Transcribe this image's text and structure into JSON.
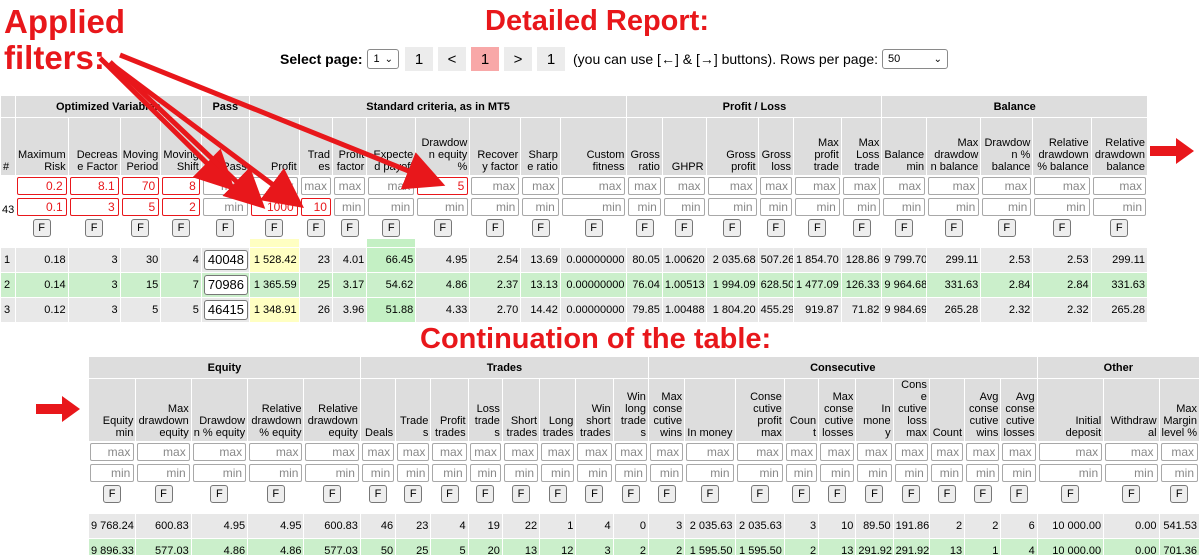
{
  "annotations": {
    "applied_filters": "Applied\nfilters:",
    "detailed_report": "Detailed Report:",
    "continuation": "Continuation of the table:"
  },
  "pager": {
    "select_label": "Select page:",
    "select_value": "1",
    "first": "1",
    "prev": "<",
    "current": "1",
    "next": ">",
    "last": "1",
    "note": "(you can use [←] & [→] buttons). Rows per page:",
    "rows_value": "50"
  },
  "filter_button": "F",
  "table1": {
    "groups": {
      "opt": "Optimized Variables",
      "pass": "Pass",
      "std": "Standard criteria, as in MT5",
      "pl": "Profit / Loss",
      "bal": "Balance"
    },
    "rows_count": "43",
    "headers": [
      "#",
      "Maximum Risk",
      "Decrease Factor",
      "Moving Period",
      "Moving Shift",
      "Pass",
      "Profit",
      "Trades",
      "Profit factor",
      "Expected payoff",
      "Drawdown equity %",
      "Recovery factor",
      "Sharpe ratio",
      "Custom fitness",
      "Gross ratio",
      "GHPR",
      "Gross profit",
      "Gross loss",
      "Max profit trade",
      "Max Loss trade",
      "Balance min",
      "Max drawdown balance",
      "Drawdown % balance",
      "Relative drawdown % balance",
      "Relative drawdown balance"
    ],
    "max_filters": [
      "0.2",
      "8.1",
      "70",
      "8",
      "max",
      "max",
      "max",
      "max",
      "max",
      "5",
      "max",
      "max",
      "max",
      "max",
      "max",
      "max",
      "max",
      "max",
      "max",
      "max",
      "max",
      "max",
      "max",
      "max"
    ],
    "min_filters": [
      "0.1",
      "3",
      "5",
      "2",
      "min",
      "1000",
      "10",
      "min",
      "min",
      "min",
      "min",
      "min",
      "min",
      "min",
      "min",
      "min",
      "min",
      "min",
      "min",
      "min",
      "min",
      "min",
      "min",
      "min"
    ],
    "rows": [
      [
        "1",
        "0.18",
        "3",
        "30",
        "4",
        "40048",
        "1 528.42",
        "23",
        "4.01",
        "66.45",
        "4.95",
        "2.54",
        "13.69",
        "0.00000000",
        "80.05",
        "1.00620",
        "2 035.68",
        "507.26",
        "1 854.70",
        "128.86",
        "9 799.70",
        "299.11",
        "2.53",
        "2.53",
        "299.11"
      ],
      [
        "2",
        "0.14",
        "3",
        "15",
        "7",
        "70986",
        "1 365.59",
        "25",
        "3.17",
        "54.62",
        "4.86",
        "2.37",
        "13.13",
        "0.00000000",
        "76.04",
        "1.00513",
        "1 994.09",
        "628.50",
        "1 477.09",
        "126.33",
        "9 964.68",
        "331.63",
        "2.84",
        "2.84",
        "331.63"
      ],
      [
        "3",
        "0.12",
        "3",
        "5",
        "5",
        "46415",
        "1 348.91",
        "26",
        "3.96",
        "51.88",
        "4.33",
        "2.70",
        "14.42",
        "0.00000000",
        "79.85",
        "1.00488",
        "1 804.20",
        "455.29",
        "919.87",
        "71.82",
        "9 984.69",
        "265.28",
        "2.32",
        "2.32",
        "265.28"
      ]
    ]
  },
  "table2": {
    "groups": {
      "eq": "Equity",
      "tr": "Trades",
      "cons": "Consecutive",
      "oth": "Other"
    },
    "headers": [
      "Equity min",
      "Max drawdown equity",
      "Drawdown % equity",
      "Relative drawdown % equity",
      "Relative drawdown equity",
      "Deals",
      "Trades",
      "Profit trades",
      "Loss trades",
      "Short trades",
      "Long trades",
      "Win short trades",
      "Win long trades",
      "Max conse cutive wins",
      "In money",
      "Conse cutive profit max",
      "Count",
      "Max conse cutive losses",
      "In money",
      "Conse cutive loss max",
      "Count",
      "Avg conse cutive wins",
      "Avg conse cutive losses",
      "Initial deposit",
      "Withdrawal",
      "Max Margin level %"
    ],
    "rows": [
      [
        "9 768.24",
        "600.83",
        "4.95",
        "4.95",
        "600.83",
        "46",
        "23",
        "4",
        "19",
        "22",
        "1",
        "4",
        "0",
        "3",
        "2 035.63",
        "2 035.63",
        "3",
        "10",
        "89.50",
        "191.86",
        "2",
        "2",
        "6",
        "10 000.00",
        "0.00",
        "541.53"
      ],
      [
        "9 896.33",
        "577.03",
        "4.86",
        "4.86",
        "577.03",
        "50",
        "25",
        "5",
        "20",
        "13",
        "12",
        "3",
        "2",
        "2",
        "1 595.50",
        "1 595.50",
        "2",
        "13",
        "291.92",
        "291.92",
        "13",
        "1",
        "4",
        "10 000.00",
        "0.00",
        "701.36"
      ]
    ]
  },
  "colors": {
    "annotation": "#e8171b",
    "header_bg": "#dddddd",
    "row_alt": "#cbefcb",
    "profit_highlight": "#ffffc2",
    "payoff_highlight": "#c4f0c4",
    "current_page": "#f8a8a8"
  }
}
